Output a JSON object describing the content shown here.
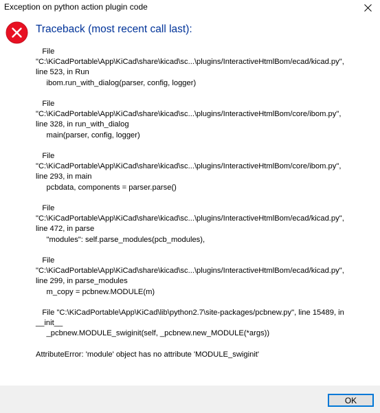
{
  "window": {
    "title": "Exception on python action plugin code"
  },
  "icons": {
    "error": "error-circle-x-icon",
    "close": "close-icon"
  },
  "colors": {
    "heading": "#003399",
    "error_icon_fill": "#e81123",
    "footer_bg": "#f0f0f0",
    "button_border": "#0078d7"
  },
  "dialog": {
    "heading": "Traceback (most recent call last):",
    "frames": [
      {
        "lines": [
          "   File",
          "\"C:\\KiCadPortable\\App\\KiCad\\share\\kicad\\sc...\\plugins/InteractiveHtmlBom/ecad/kicad.py\",",
          "line 523, in Run",
          "     ibom.run_with_dialog(parser, config, logger)"
        ]
      },
      {
        "lines": [
          "   File",
          "\"C:\\KiCadPortable\\App\\KiCad\\share\\kicad\\sc...\\plugins/InteractiveHtmlBom/core/ibom.py\",",
          "line 328, in run_with_dialog",
          "     main(parser, config, logger)"
        ]
      },
      {
        "lines": [
          "   File",
          "\"C:\\KiCadPortable\\App\\KiCad\\share\\kicad\\sc...\\plugins/InteractiveHtmlBom/core/ibom.py\",",
          "line 293, in main",
          "     pcbdata, components = parser.parse()"
        ]
      },
      {
        "lines": [
          "   File",
          "\"C:\\KiCadPortable\\App\\KiCad\\share\\kicad\\sc...\\plugins/InteractiveHtmlBom/ecad/kicad.py\",",
          "line 472, in parse",
          "     \"modules\": self.parse_modules(pcb_modules),"
        ]
      },
      {
        "lines": [
          "   File",
          "\"C:\\KiCadPortable\\App\\KiCad\\share\\kicad\\sc...\\plugins/InteractiveHtmlBom/ecad/kicad.py\",",
          "line 299, in parse_modules",
          "     m_copy = pcbnew.MODULE(m)"
        ]
      },
      {
        "lines": [
          "   File \"C:\\KiCadPortable\\App\\KiCad\\lib\\python2.7\\site-packages/pcbnew.py\", line 15489, in",
          "__init__",
          "     _pcbnew.MODULE_swiginit(self, _pcbnew.new_MODULE(*args))"
        ]
      }
    ],
    "error_message": "AttributeError: 'module' object has no attribute 'MODULE_swiginit'"
  },
  "footer": {
    "ok_label": "OK"
  }
}
